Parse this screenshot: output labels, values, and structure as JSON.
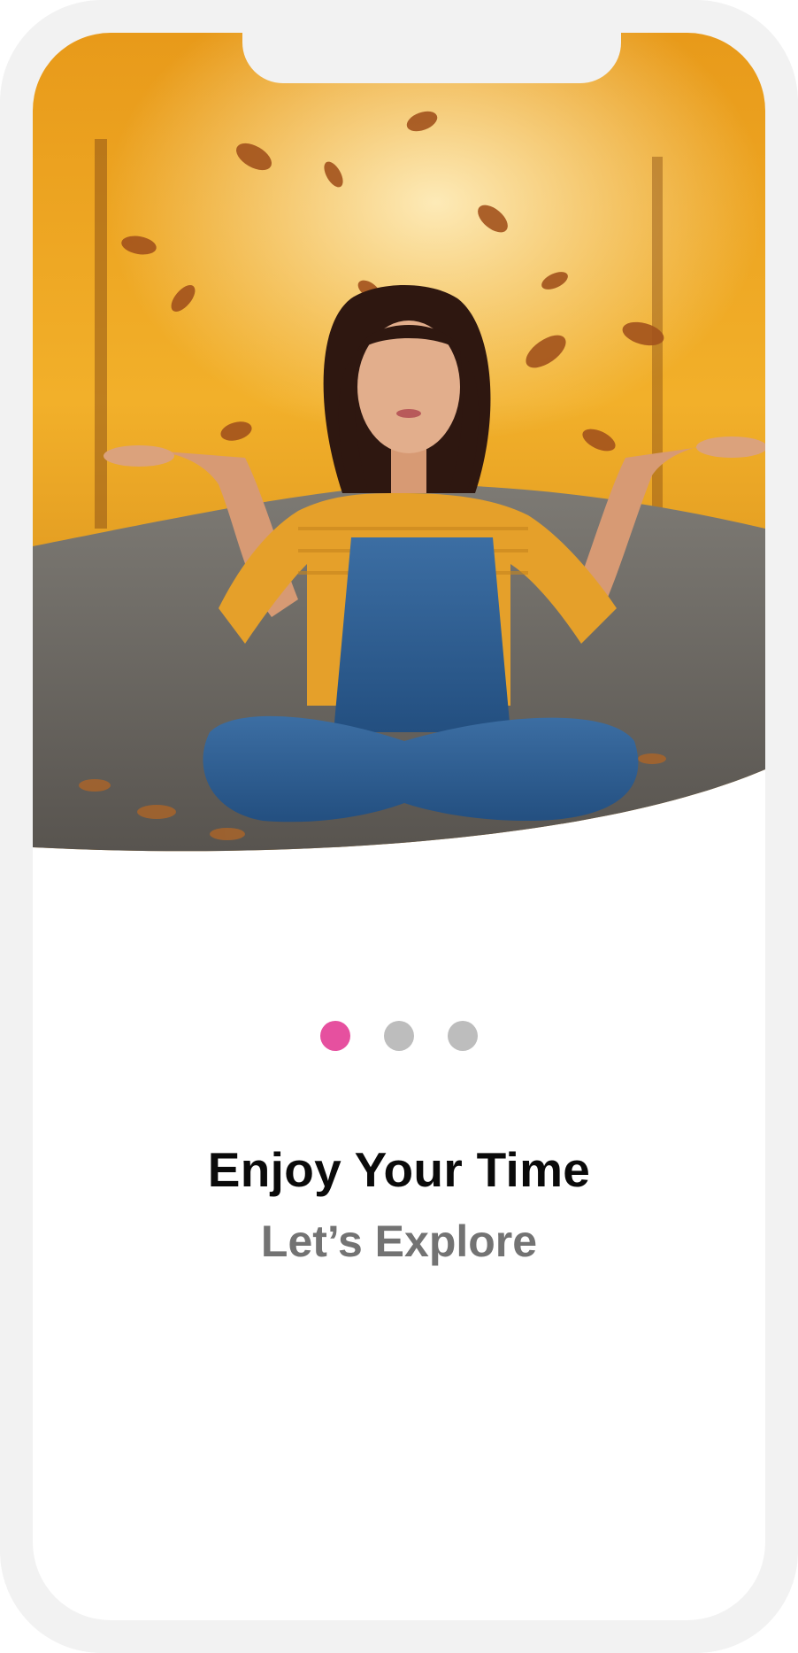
{
  "onboarding": {
    "hero_image": "woman-sitting-on-autumn-road-throwing-leaves",
    "title": "Enjoy Your Time",
    "subtitle": "Let’s Explore",
    "pager": {
      "total": 3,
      "active_index": 0
    },
    "colors": {
      "accent": "#e6509f",
      "dot_inactive": "#bdbdbd",
      "frame": "#f2f2f2",
      "title": "#0a0a0a",
      "subtitle": "#737373"
    }
  }
}
